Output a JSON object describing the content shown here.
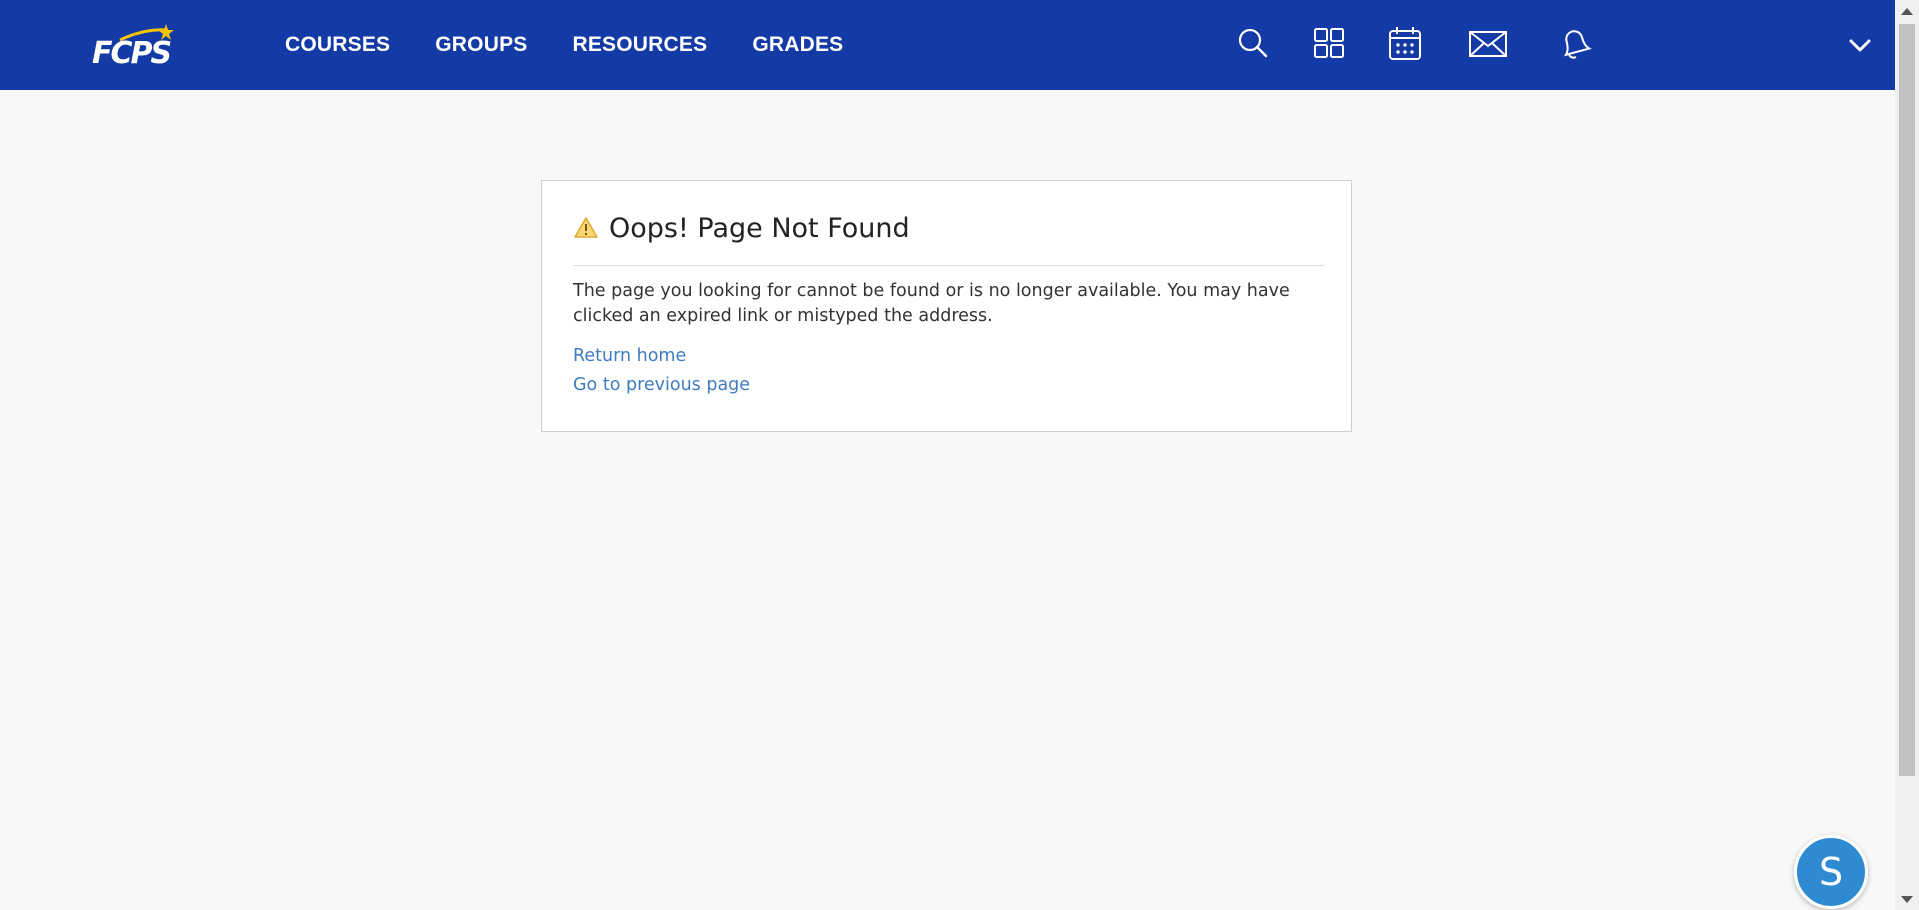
{
  "header": {
    "logo_text": "FCPS",
    "brand_color": "#133aa5",
    "nav": [
      {
        "label": "COURSES"
      },
      {
        "label": "GROUPS"
      },
      {
        "label": "RESOURCES"
      },
      {
        "label": "GRADES"
      }
    ],
    "icons": [
      "search-icon",
      "apps-grid-icon",
      "calendar-icon",
      "mail-icon",
      "bell-icon",
      "chevron-down-icon"
    ]
  },
  "error_card": {
    "title": "Oops! Page Not Found",
    "icon": "warning-icon",
    "message": "The page you looking for cannot be found or is no longer available. You may have clicked an expired link or mistyped the address.",
    "links": [
      {
        "label": "Return home"
      },
      {
        "label": "Go to previous page"
      }
    ],
    "link_color": "#3f7cbf"
  },
  "fab": {
    "label": "S",
    "color": "#2f8bd1"
  }
}
